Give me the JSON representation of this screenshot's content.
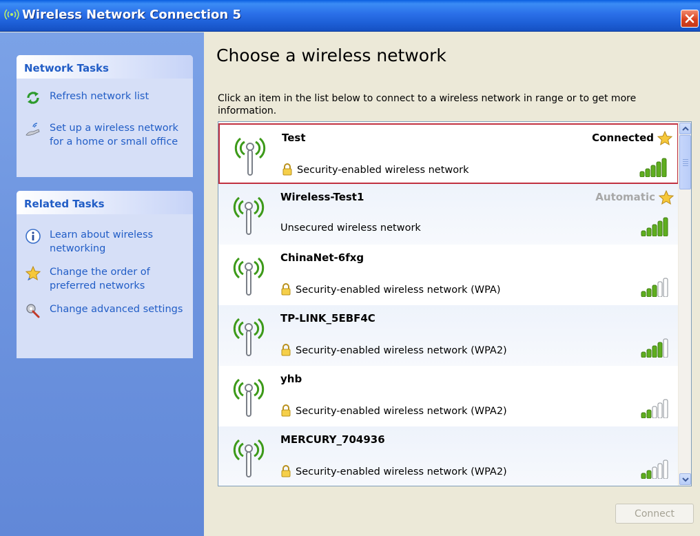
{
  "window": {
    "title": "Wireless Network Connection 5",
    "icon": "wireless-icon"
  },
  "sidebar": {
    "network_tasks": {
      "header": "Network Tasks",
      "items": [
        {
          "label": "Refresh network list",
          "icon": "refresh-icon"
        },
        {
          "label": "Set up a wireless network for a home or small office",
          "icon": "wireless-setup-icon"
        }
      ]
    },
    "related_tasks": {
      "header": "Related Tasks",
      "items": [
        {
          "label": "Learn about wireless networking",
          "icon": "info-icon"
        },
        {
          "label": "Change the order of preferred networks",
          "icon": "star-icon"
        },
        {
          "label": "Change advanced settings",
          "icon": "settings-icon"
        }
      ]
    }
  },
  "main": {
    "title": "Choose a wireless network",
    "description": "Click an item in the list below to connect to a wireless network in range or to get more information.",
    "networks": [
      {
        "name": "Test",
        "security": "Security-enabled wireless network",
        "secured": true,
        "status": "Connected",
        "preferred": true,
        "signal_bars": 5,
        "selected": true
      },
      {
        "name": "Wireless-Test1",
        "security": "Unsecured wireless network",
        "secured": false,
        "status": "Automatic",
        "preferred": true,
        "signal_bars": 5,
        "selected": false
      },
      {
        "name": "ChinaNet-6fxg",
        "security": "Security-enabled wireless network (WPA)",
        "secured": true,
        "status": "",
        "preferred": false,
        "signal_bars": 3,
        "selected": false
      },
      {
        "name": "TP-LINK_5EBF4C",
        "security": "Security-enabled wireless network (WPA2)",
        "secured": true,
        "status": "",
        "preferred": false,
        "signal_bars": 4,
        "selected": false
      },
      {
        "name": "yhb",
        "security": "Security-enabled wireless network (WPA2)",
        "secured": true,
        "status": "",
        "preferred": false,
        "signal_bars": 2,
        "selected": false
      },
      {
        "name": "MERCURY_704936",
        "security": "Security-enabled wireless network (WPA2)",
        "secured": true,
        "status": "",
        "preferred": false,
        "signal_bars": 2,
        "selected": false
      }
    ],
    "connect_label": "Connect"
  },
  "colors": {
    "title_bar": "#2a6fe8",
    "task_link": "#215dc6",
    "selection_border": "#c1303f",
    "signal_on": "#5fae1f",
    "dim_text": "#a7a7a7"
  }
}
